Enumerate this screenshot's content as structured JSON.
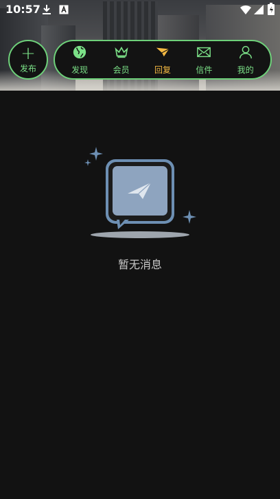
{
  "status_bar": {
    "time": "10:57"
  },
  "nav": {
    "publish_label": "发布",
    "items": [
      {
        "label": "发现",
        "icon": "globe-icon"
      },
      {
        "label": "会员",
        "icon": "crown-icon"
      },
      {
        "label": "回复",
        "icon": "reply-icon"
      },
      {
        "label": "信件",
        "icon": "mail-icon"
      },
      {
        "label": "我的",
        "icon": "user-icon"
      }
    ]
  },
  "empty_state": {
    "message": "暂无消息",
    "icon": "empty-message-illustration"
  },
  "colors": {
    "accent_green": "#6ed17a",
    "active_orange": "#f5b942",
    "background": "#121212",
    "illustration_blue": "#7f9ab7"
  }
}
